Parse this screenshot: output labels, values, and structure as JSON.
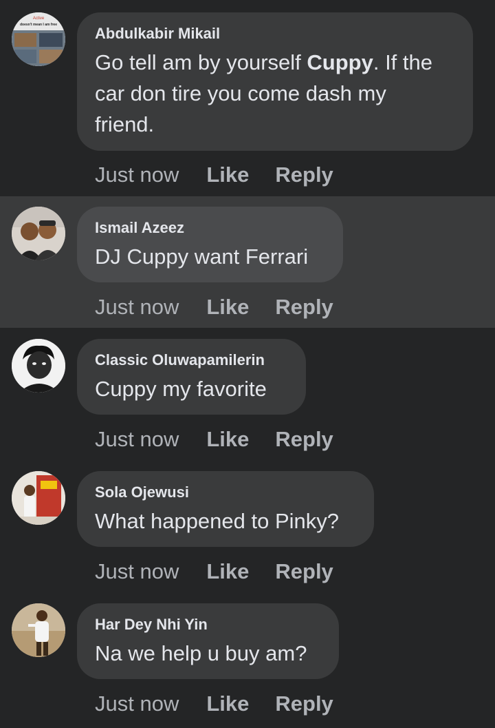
{
  "comments": [
    {
      "author": "Abdulkabir Mikail",
      "text_lines": [
        "Go tell am by yourself ",
        "Cuppy",
        ". If the",
        "car don tire you come dash my",
        "friend."
      ],
      "time": "Just now",
      "like_label": "Like",
      "reply_label": "Reply",
      "avatar_caption_1": "Active",
      "avatar_caption_2": "doesn't mean I am free"
    },
    {
      "author": "Ismail Azeez",
      "text": "DJ Cuppy want Ferrari",
      "time": "Just now",
      "like_label": "Like",
      "reply_label": "Reply"
    },
    {
      "author": "Classic Oluwapamilerin",
      "text": "Cuppy my favorite",
      "time": "Just now",
      "like_label": "Like",
      "reply_label": "Reply"
    },
    {
      "author": "Sola Ojewusi",
      "text": "What happened to Pinky?",
      "time": "Just now",
      "like_label": "Like",
      "reply_label": "Reply"
    },
    {
      "author": "Har Dey Nhi Yin",
      "text": "Na we help u buy am?",
      "time": "Just now",
      "like_label": "Like",
      "reply_label": "Reply"
    }
  ],
  "colors": {
    "background": "#242526",
    "highlight_background": "#3a3b3c",
    "bubble": "#3a3b3c",
    "text": "#e4e6eb",
    "secondary_text": "#b0b3b8"
  }
}
